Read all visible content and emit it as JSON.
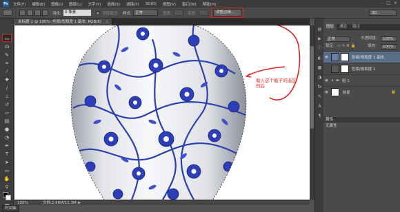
{
  "app": {
    "logo": "Ps"
  },
  "menubar": {
    "items": [
      "文件(F)",
      "编辑(E)",
      "图像(I)",
      "图层(L)",
      "文字(Y)",
      "选择(S)",
      "滤镜(T)",
      "3D(D)",
      "视图(V)",
      "窗口(W)",
      "帮助(H)"
    ],
    "window_controls": [
      "–",
      "□",
      "✕"
    ]
  },
  "options_bar": {
    "feather_label": "羽化:",
    "feather_value": "0 像素",
    "antialias_label": "消除锯齿",
    "style_label": "样式:",
    "style_value": "正常",
    "width_label": "宽度:",
    "height_label": "高度:",
    "refine_edge_label": "调整边缘...",
    "workspace_value": "3D"
  },
  "document": {
    "tab_title": "未标题-1 @ 100% (色相/饱和度 1 副本, RGB/8)",
    "close_glyph": "×"
  },
  "status": {
    "zoom": "100%",
    "doc_size": "文档:2.86M/11.3M",
    "arrow": "▶",
    "timeline_tab": "时间轴"
  },
  "layers_panel": {
    "tabs": [
      "图层",
      "通道",
      "路径"
    ],
    "kind_label": "正常",
    "opacity_label": "不透明度:",
    "opacity_value": "100%",
    "lock_label": "锁定:",
    "fill_label": "填充:",
    "fill_value": "100%",
    "layers": [
      {
        "name": "色相/饱和度 1 副本",
        "selected": true,
        "italic": false,
        "type": "adjust"
      },
      {
        "name": "色相/饱和度 1",
        "selected": false,
        "italic": false,
        "type": "adjust"
      },
      {
        "name": "组 1",
        "selected": false,
        "italic": false,
        "type": "group"
      },
      {
        "name": "背景",
        "selected": false,
        "italic": true,
        "type": "bg"
      }
    ]
  },
  "properties_panel": {
    "title": "属性",
    "subtitle": "无属性"
  },
  "annotation": {
    "line1": "载入这个瓶子的选区",
    "line2": "然后"
  },
  "colors": {
    "highlight": "#e02020",
    "selected_layer": "#596d86",
    "porcelain_blue": "#2a3fb0"
  }
}
